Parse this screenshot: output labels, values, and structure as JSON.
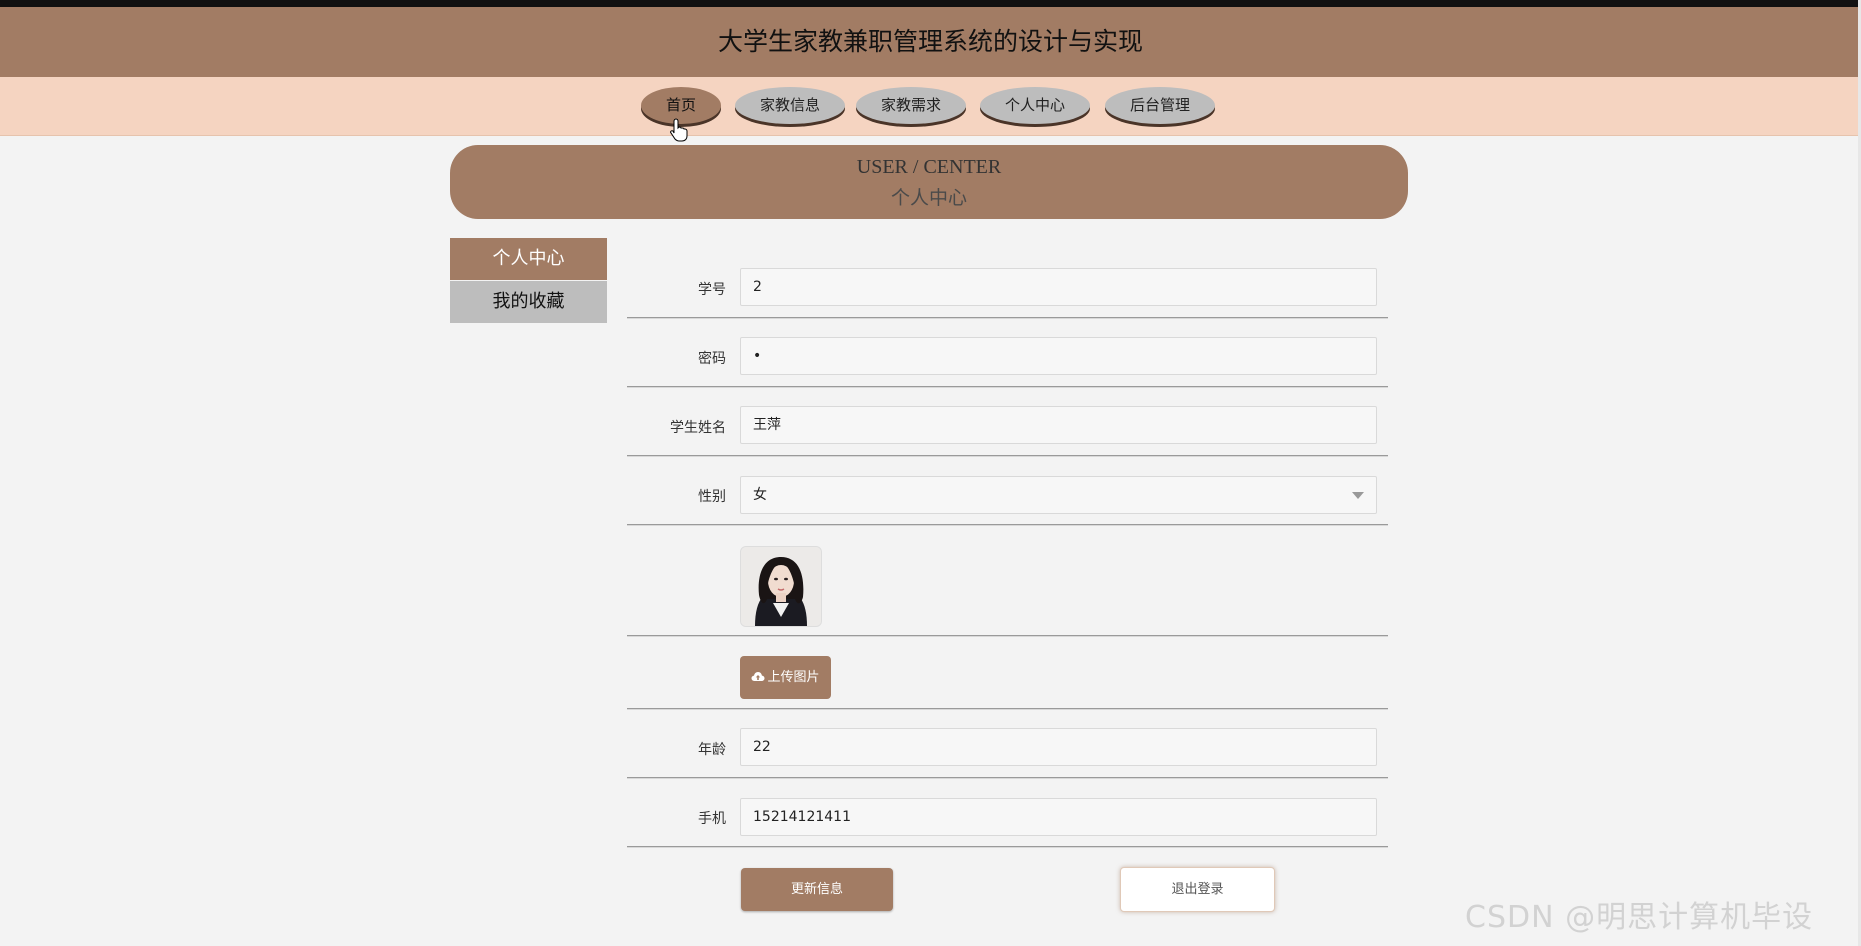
{
  "header": {
    "title": "大学生家教兼职管理系统的设计与实现"
  },
  "nav": {
    "items": [
      {
        "label": "首页"
      },
      {
        "label": "家教信息"
      },
      {
        "label": "家教需求"
      },
      {
        "label": "个人中心"
      },
      {
        "label": "后台管理"
      }
    ],
    "active_index": 0
  },
  "banner": {
    "title_en": "USER / CENTER",
    "title_cn": "个人中心"
  },
  "sidebar": {
    "items": [
      {
        "label": "个人中心"
      },
      {
        "label": "我的收藏"
      }
    ],
    "active_index": 0
  },
  "form": {
    "student_id": {
      "label": "学号",
      "value": "2"
    },
    "password": {
      "label": "密码",
      "value": "•"
    },
    "student_name": {
      "label": "学生姓名",
      "value": "王萍"
    },
    "gender": {
      "label": "性别",
      "value": "女"
    },
    "upload_label": "上传图片",
    "age": {
      "label": "年龄",
      "value": "22"
    },
    "phone": {
      "label": "手机",
      "value": "15214121411"
    }
  },
  "actions": {
    "update_label": "更新信息",
    "logout_label": "退出登录"
  },
  "watermark": "CSDN @明思计算机毕设",
  "colors": {
    "brand": "#a27c64",
    "nav_bg": "#f5d4c1",
    "page_bg": "#f3f3f3",
    "inactive": "#bdbdbd"
  }
}
